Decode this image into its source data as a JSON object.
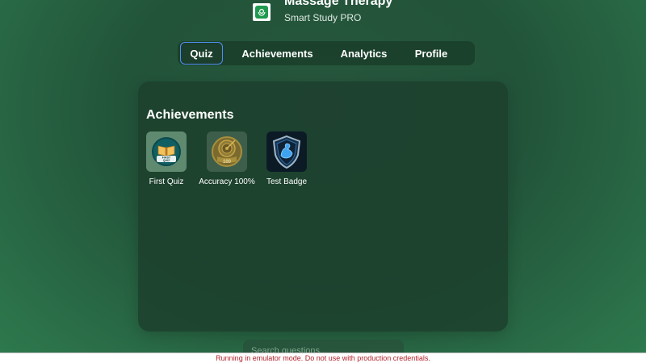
{
  "app": {
    "title": "Massage Therapy",
    "subtitle": "Smart Study PRO",
    "logo_icon": "massage-hands-icon",
    "accent_color": "#1f9a4f"
  },
  "tabs": [
    {
      "label": "Quiz",
      "active": true
    },
    {
      "label": "Achievements",
      "active": false
    },
    {
      "label": "Analytics",
      "active": false
    },
    {
      "label": "Profile",
      "active": false
    }
  ],
  "achievements": {
    "title": "Achievements",
    "badges": [
      {
        "label": "First Quiz",
        "icon": "open-book-icon",
        "emblem_text": "FIRST QUIZ"
      },
      {
        "label": "Accuracy 100%",
        "icon": "target-icon",
        "emblem_text": "100"
      },
      {
        "label": "Test Badge",
        "icon": "flexed-arm-shield-icon"
      }
    ]
  },
  "search": {
    "placeholder": "Search questions..."
  },
  "emulator_notice": "Running in emulator mode. Do not use with production credentials."
}
